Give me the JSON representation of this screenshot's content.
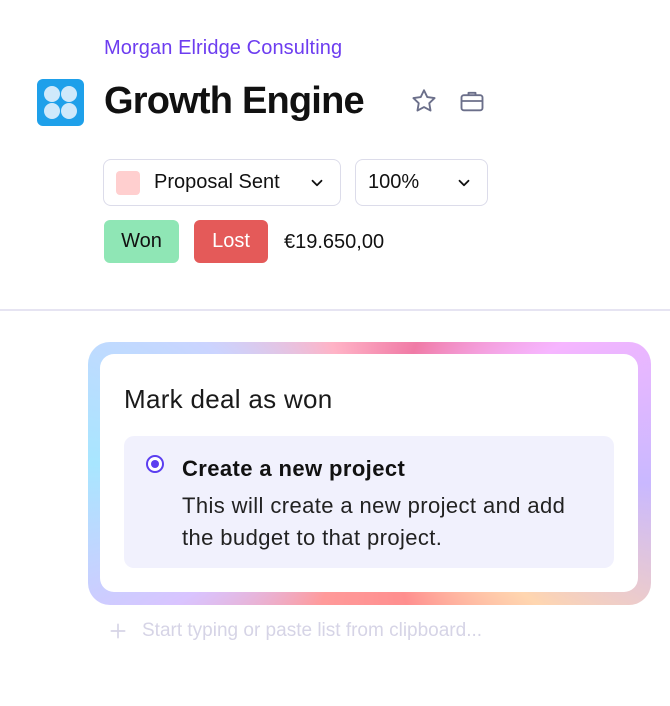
{
  "header": {
    "company": "Morgan Elridge Consulting",
    "title": "Growth Engine",
    "app_icon": "app-logo-icon",
    "actions": [
      {
        "name": "star-icon"
      },
      {
        "name": "briefcase-icon"
      }
    ]
  },
  "deal": {
    "stage": {
      "label": "Proposal Sent",
      "color": "#ffcfcf"
    },
    "probability": "100%",
    "won_label": "Won",
    "lost_label": "Lost",
    "amount": "€19.650,00"
  },
  "dialog": {
    "title": "Mark deal as won",
    "option": {
      "title": "Create a new project",
      "description": "This will create a new project and add the budget to that project.",
      "selected": true
    }
  },
  "add_input": {
    "placeholder": "Start typing or paste list from clipboard..."
  },
  "colors": {
    "accent": "#6d3df0",
    "won": "#8fe6b5",
    "lost": "#e45a59",
    "option_bg": "#f1f1fd"
  }
}
